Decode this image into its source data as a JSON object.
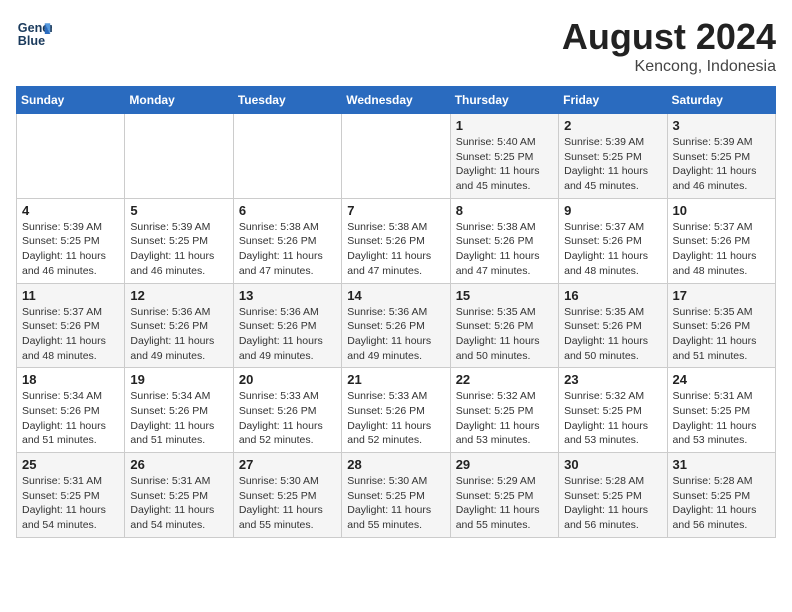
{
  "header": {
    "logo_line1": "General",
    "logo_line2": "Blue",
    "month": "August 2024",
    "location": "Kencong, Indonesia"
  },
  "weekdays": [
    "Sunday",
    "Monday",
    "Tuesday",
    "Wednesday",
    "Thursday",
    "Friday",
    "Saturday"
  ],
  "weeks": [
    [
      {
        "day": "",
        "info": ""
      },
      {
        "day": "",
        "info": ""
      },
      {
        "day": "",
        "info": ""
      },
      {
        "day": "",
        "info": ""
      },
      {
        "day": "1",
        "info": "Sunrise: 5:40 AM\nSunset: 5:25 PM\nDaylight: 11 hours\nand 45 minutes."
      },
      {
        "day": "2",
        "info": "Sunrise: 5:39 AM\nSunset: 5:25 PM\nDaylight: 11 hours\nand 45 minutes."
      },
      {
        "day": "3",
        "info": "Sunrise: 5:39 AM\nSunset: 5:25 PM\nDaylight: 11 hours\nand 46 minutes."
      }
    ],
    [
      {
        "day": "4",
        "info": "Sunrise: 5:39 AM\nSunset: 5:25 PM\nDaylight: 11 hours\nand 46 minutes."
      },
      {
        "day": "5",
        "info": "Sunrise: 5:39 AM\nSunset: 5:25 PM\nDaylight: 11 hours\nand 46 minutes."
      },
      {
        "day": "6",
        "info": "Sunrise: 5:38 AM\nSunset: 5:26 PM\nDaylight: 11 hours\nand 47 minutes."
      },
      {
        "day": "7",
        "info": "Sunrise: 5:38 AM\nSunset: 5:26 PM\nDaylight: 11 hours\nand 47 minutes."
      },
      {
        "day": "8",
        "info": "Sunrise: 5:38 AM\nSunset: 5:26 PM\nDaylight: 11 hours\nand 47 minutes."
      },
      {
        "day": "9",
        "info": "Sunrise: 5:37 AM\nSunset: 5:26 PM\nDaylight: 11 hours\nand 48 minutes."
      },
      {
        "day": "10",
        "info": "Sunrise: 5:37 AM\nSunset: 5:26 PM\nDaylight: 11 hours\nand 48 minutes."
      }
    ],
    [
      {
        "day": "11",
        "info": "Sunrise: 5:37 AM\nSunset: 5:26 PM\nDaylight: 11 hours\nand 48 minutes."
      },
      {
        "day": "12",
        "info": "Sunrise: 5:36 AM\nSunset: 5:26 PM\nDaylight: 11 hours\nand 49 minutes."
      },
      {
        "day": "13",
        "info": "Sunrise: 5:36 AM\nSunset: 5:26 PM\nDaylight: 11 hours\nand 49 minutes."
      },
      {
        "day": "14",
        "info": "Sunrise: 5:36 AM\nSunset: 5:26 PM\nDaylight: 11 hours\nand 49 minutes."
      },
      {
        "day": "15",
        "info": "Sunrise: 5:35 AM\nSunset: 5:26 PM\nDaylight: 11 hours\nand 50 minutes."
      },
      {
        "day": "16",
        "info": "Sunrise: 5:35 AM\nSunset: 5:26 PM\nDaylight: 11 hours\nand 50 minutes."
      },
      {
        "day": "17",
        "info": "Sunrise: 5:35 AM\nSunset: 5:26 PM\nDaylight: 11 hours\nand 51 minutes."
      }
    ],
    [
      {
        "day": "18",
        "info": "Sunrise: 5:34 AM\nSunset: 5:26 PM\nDaylight: 11 hours\nand 51 minutes."
      },
      {
        "day": "19",
        "info": "Sunrise: 5:34 AM\nSunset: 5:26 PM\nDaylight: 11 hours\nand 51 minutes."
      },
      {
        "day": "20",
        "info": "Sunrise: 5:33 AM\nSunset: 5:26 PM\nDaylight: 11 hours\nand 52 minutes."
      },
      {
        "day": "21",
        "info": "Sunrise: 5:33 AM\nSunset: 5:26 PM\nDaylight: 11 hours\nand 52 minutes."
      },
      {
        "day": "22",
        "info": "Sunrise: 5:32 AM\nSunset: 5:25 PM\nDaylight: 11 hours\nand 53 minutes."
      },
      {
        "day": "23",
        "info": "Sunrise: 5:32 AM\nSunset: 5:25 PM\nDaylight: 11 hours\nand 53 minutes."
      },
      {
        "day": "24",
        "info": "Sunrise: 5:31 AM\nSunset: 5:25 PM\nDaylight: 11 hours\nand 53 minutes."
      }
    ],
    [
      {
        "day": "25",
        "info": "Sunrise: 5:31 AM\nSunset: 5:25 PM\nDaylight: 11 hours\nand 54 minutes."
      },
      {
        "day": "26",
        "info": "Sunrise: 5:31 AM\nSunset: 5:25 PM\nDaylight: 11 hours\nand 54 minutes."
      },
      {
        "day": "27",
        "info": "Sunrise: 5:30 AM\nSunset: 5:25 PM\nDaylight: 11 hours\nand 55 minutes."
      },
      {
        "day": "28",
        "info": "Sunrise: 5:30 AM\nSunset: 5:25 PM\nDaylight: 11 hours\nand 55 minutes."
      },
      {
        "day": "29",
        "info": "Sunrise: 5:29 AM\nSunset: 5:25 PM\nDaylight: 11 hours\nand 55 minutes."
      },
      {
        "day": "30",
        "info": "Sunrise: 5:28 AM\nSunset: 5:25 PM\nDaylight: 11 hours\nand 56 minutes."
      },
      {
        "day": "31",
        "info": "Sunrise: 5:28 AM\nSunset: 5:25 PM\nDaylight: 11 hours\nand 56 minutes."
      }
    ]
  ]
}
